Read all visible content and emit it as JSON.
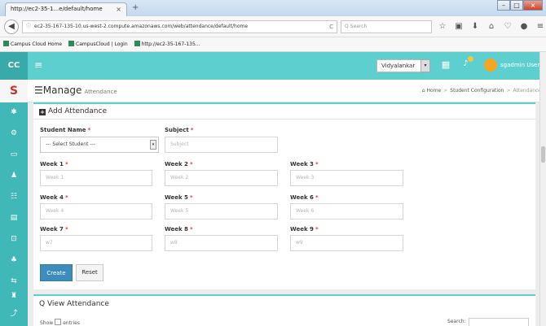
{
  "browser": {
    "tab_title": "http://ec2-35-1...e/default/home",
    "tab_close": "×",
    "new_tab": "+",
    "window_buttons": {
      "minimize": "–",
      "maximize": "□",
      "close": "×"
    },
    "back_icon": "◀",
    "info_icon": "ⓘ",
    "url": "ec2-35-167-135-10.us-west-2.compute.amazonaws.com/web/attendance/default/home",
    "reload_icon": "C",
    "search_placeholder": "Q  Search",
    "nav_icons": [
      "☆",
      "▣",
      "⬇",
      "⌂",
      "♡",
      "●",
      "≡"
    ]
  },
  "bookmarks": [
    "Campus Cloud Home",
    "CampusCloud | Login",
    "http://ec2-35-167-135..."
  ],
  "app": {
    "brand": "CC",
    "menu_icon": "≡",
    "institute": "Vidyalankar",
    "dropdown_icon": "▾",
    "grid_icon": "▦",
    "bell_icon": "♪",
    "user": "sgadmin User"
  },
  "sidebar": {
    "logo": "S",
    "items": [
      "✱",
      "⚙",
      "▭",
      "♟",
      "☷",
      "▤",
      "⊡",
      "♣",
      "⇆",
      "♜",
      "⤴"
    ]
  },
  "page": {
    "title": "Manage",
    "subtitle": "Attendance",
    "title_icon": "☰",
    "breadcrumb": [
      "Home",
      "Student Configuration",
      "Attendance"
    ],
    "crumb_sep": ">",
    "home_icon": "⌂"
  },
  "form": {
    "header": "Add Attendance",
    "header_icon": "+",
    "required_mark": "*",
    "student_label": "Student Name",
    "student_value": "--- Select Student ---",
    "select_arrow": "▾",
    "subject_label": "Subject",
    "subject_placeholder": "Subject",
    "weeks": [
      {
        "label": "Week 1",
        "placeholder": "Week 1"
      },
      {
        "label": "Week 2",
        "placeholder": "Week 2"
      },
      {
        "label": "Week 3",
        "placeholder": "Week 3"
      },
      {
        "label": "Week 4",
        "placeholder": "Week 4"
      },
      {
        "label": "Week 5",
        "placeholder": "Week 5"
      },
      {
        "label": "Week 6",
        "placeholder": "Week 6"
      },
      {
        "label": "Week 7",
        "placeholder": "w7"
      },
      {
        "label": "Week 8",
        "placeholder": "w8"
      },
      {
        "label": "Week 9",
        "placeholder": "w9"
      }
    ],
    "create_label": "Create",
    "reset_label": "Reset"
  },
  "view": {
    "header": "View Attendance",
    "header_icon": "Q",
    "show_label": "Show",
    "entries_label": "entries",
    "search_label": "Search:"
  }
}
